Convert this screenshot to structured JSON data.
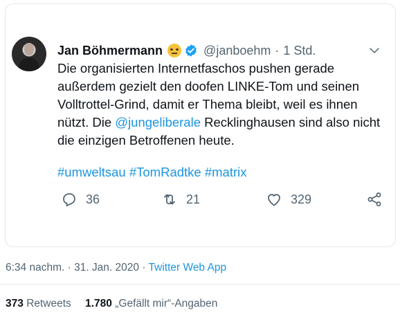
{
  "tweet": {
    "author_name": "Jan Böhmermann",
    "handle": "@janboehm",
    "separator": "·",
    "relative_time": "1 Std.",
    "text_part1": "Die organisierten Internetfaschos pushen gerade außerdem gezielt den doofen LINKE-Tom und seinen Volltrottel-Grind, damit er Thema bleibt, weil es ihnen nützt. Die ",
    "mention": "@jungeliberale",
    "text_part2": " Recklinghausen sind also nicht die einzigen Betroffenen heute.",
    "hashtags": [
      "#umweltsau",
      "#TomRadtke",
      "#matrix"
    ],
    "reply_count": "36",
    "retweet_count": "21",
    "like_count": "329"
  },
  "meta": {
    "timestamp": "6:34 nachm. · 31. Jan. 2020 · ",
    "source": "Twitter Web App"
  },
  "stats": {
    "retweets_value": "373",
    "retweets_label": "Retweets",
    "likes_value": "1.780",
    "likes_label": "„Gefällt mir“-Angaben"
  },
  "icons": {
    "emoji": "face-with-raised-eyebrow-icon",
    "verified": "verified-badge-icon",
    "menu": "chevron-down-icon",
    "reply": "reply-icon",
    "retweet": "retweet-icon",
    "like": "heart-icon",
    "share": "share-icon"
  },
  "colors": {
    "accent": "#1b95e0",
    "secondary_text": "#536471",
    "border": "#e1e8ed"
  }
}
